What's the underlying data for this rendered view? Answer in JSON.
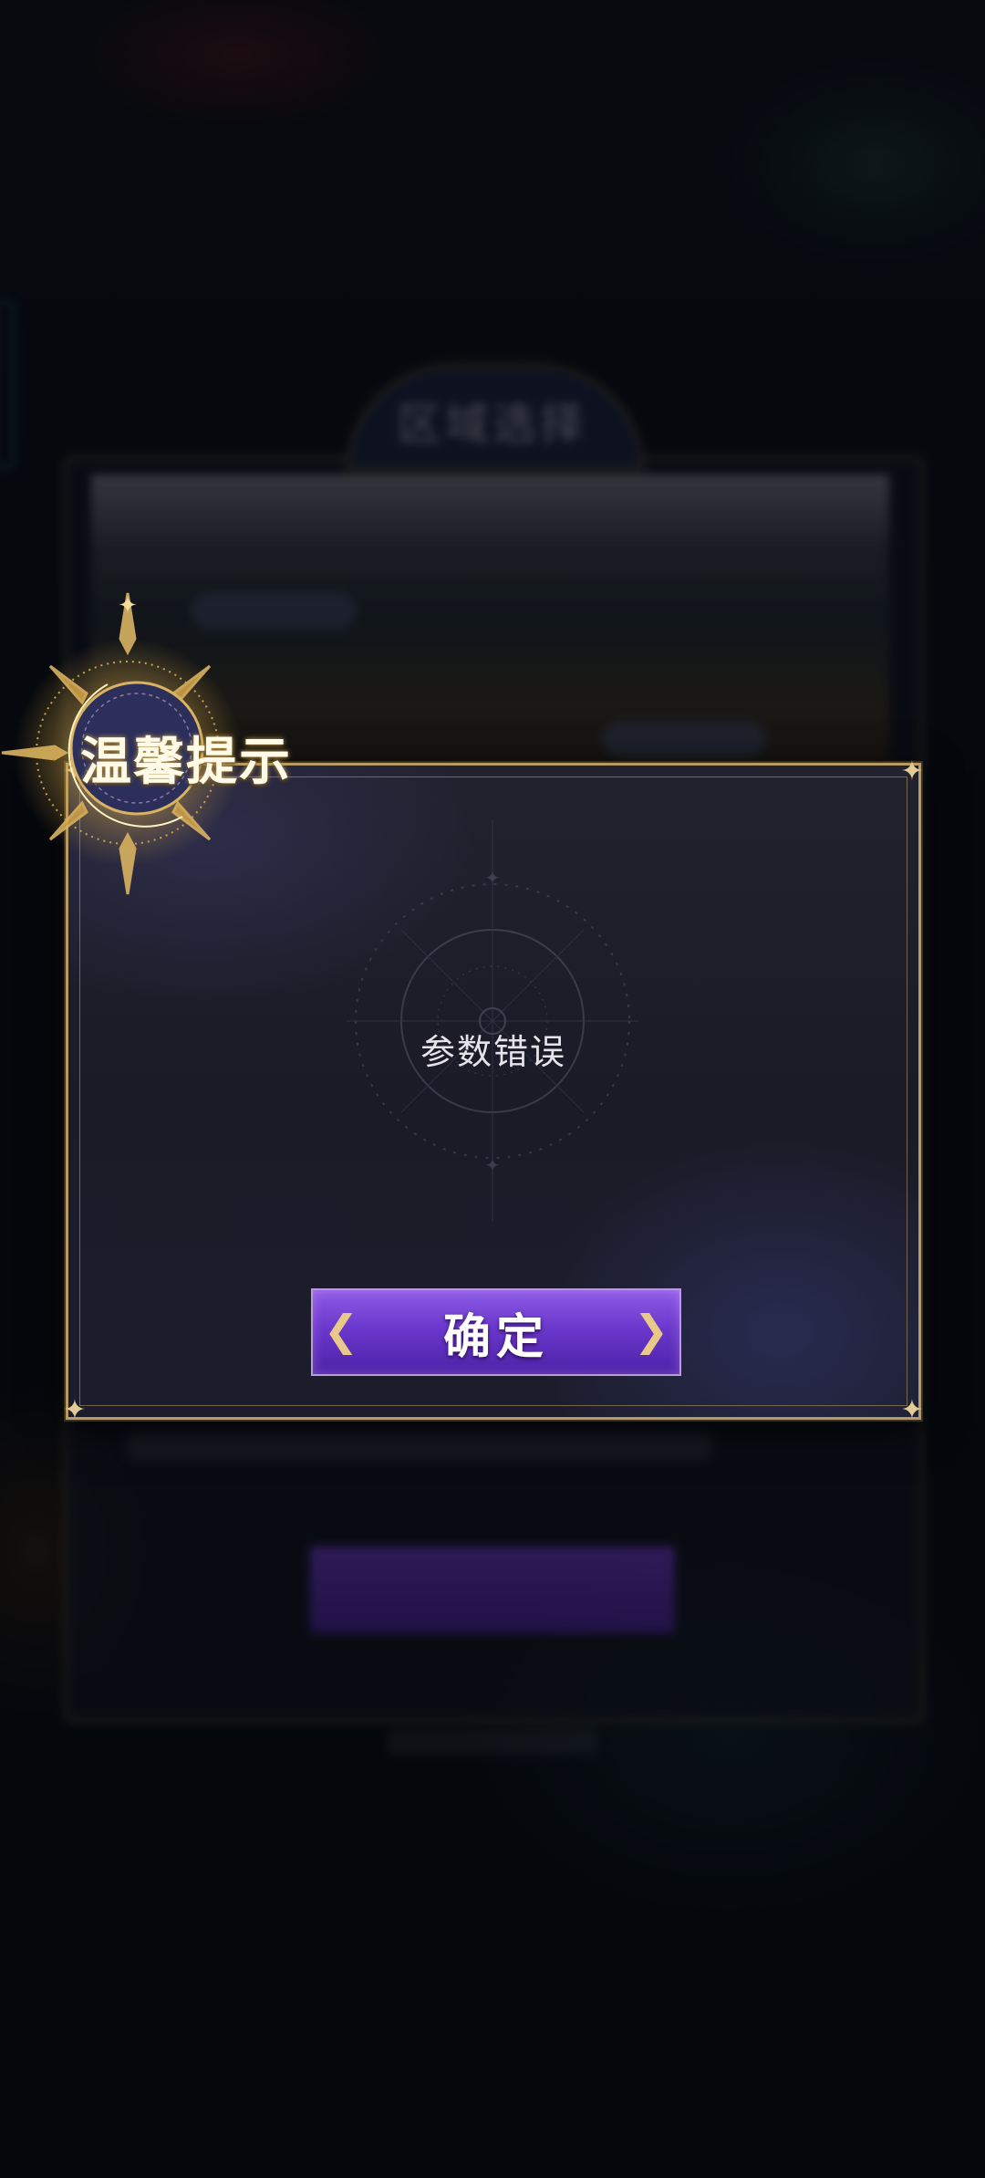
{
  "background": {
    "panel_title": "区域选择"
  },
  "dialog": {
    "title": "温馨提示",
    "message": "参数错误",
    "confirm_label": "确定"
  },
  "colors": {
    "frame_gold": "#b89a63",
    "button_purple": "#6a38cc",
    "dialog_bg": "#1c1c28"
  },
  "icons": {
    "emblem": "crescent-moon-emblem-icon",
    "corner": "star-corner-icon"
  }
}
